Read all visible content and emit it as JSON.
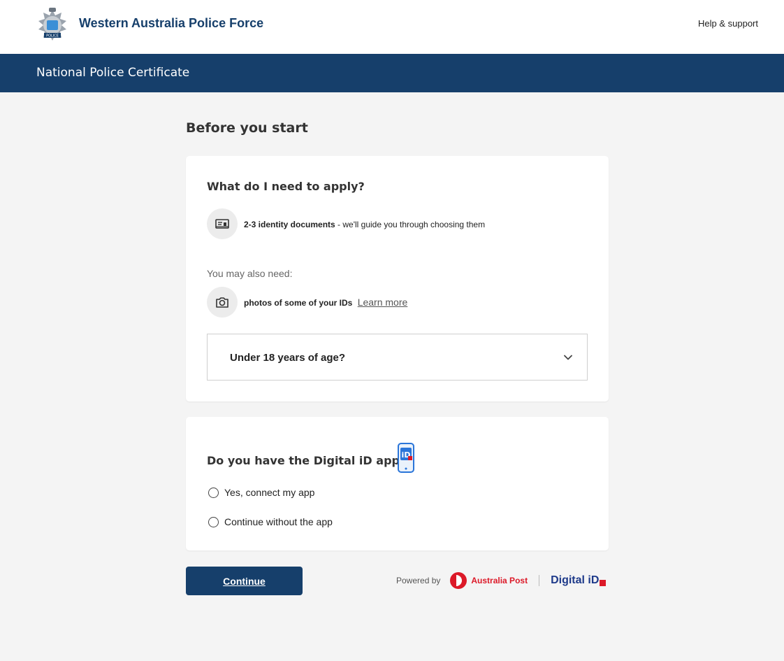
{
  "header": {
    "brand": "Western Australia Police Force",
    "help": "Help & support",
    "logo_text": "POLICE"
  },
  "nav": {
    "title": "National Police Certificate"
  },
  "page": {
    "heading": "Before you start"
  },
  "requirements": {
    "title": "What do I need to apply?",
    "item1_bold": "2-3 identity documents",
    "item1_rest": " - we'll guide you through choosing them",
    "may_also": "You may also need:",
    "item2_bold": "photos of some of your IDs",
    "learn_more": "Learn more",
    "accordion": "Under 18 years of age?"
  },
  "digital_id": {
    "question": "Do you have the Digital iD app?",
    "options": [
      "Yes, connect my app",
      "Continue without the app"
    ],
    "selected": null
  },
  "footer": {
    "continue": "Continue",
    "powered_by": "Powered by",
    "australia_post": "Australia Post",
    "digital_id_brand": "Digital iD"
  },
  "colors": {
    "brand_navy": "#163f6b",
    "auspost_red": "#dc1928",
    "digital_id_blue": "#1e3a8a"
  },
  "icons": [
    "police-crest-icon",
    "id-card-icon",
    "camera-icon",
    "chevron-down-icon",
    "digital-id-app-icon",
    "australia-post-icon"
  ]
}
